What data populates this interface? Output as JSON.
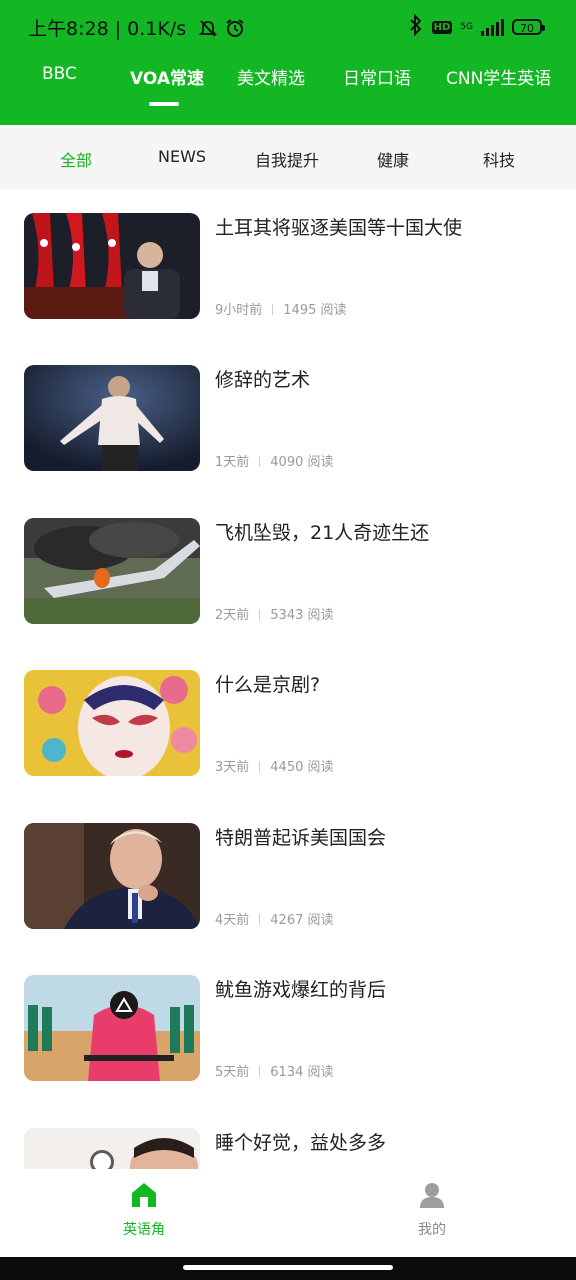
{
  "status": {
    "time": "上午8:28",
    "speed": "0.1K/s",
    "battery": "70",
    "network": "5G"
  },
  "top_tabs": [
    "BBC",
    "VOA常速",
    "美文精选",
    "日常口语",
    "CNN学生英语"
  ],
  "top_active": "VOA常速",
  "sub_tabs": [
    "全部",
    "NEWS",
    "自我提升",
    "健康",
    "科技"
  ],
  "sub_active": "全部",
  "articles": [
    {
      "title": "土耳其将驱逐美国等十国大使",
      "time": "9小时前",
      "reads": "1495 阅读"
    },
    {
      "title": "修辞的艺术",
      "time": "1天前",
      "reads": "4090 阅读"
    },
    {
      "title": "飞机坠毁，21人奇迹生还",
      "time": "2天前",
      "reads": "5343 阅读"
    },
    {
      "title": "什么是京剧?",
      "time": "3天前",
      "reads": "4450 阅读"
    },
    {
      "title": "特朗普起诉美国国会",
      "time": "4天前",
      "reads": "4267 阅读"
    },
    {
      "title": "鱿鱼游戏爆红的背后",
      "time": "5天前",
      "reads": "6134 阅读"
    },
    {
      "title": "睡个好觉，益处多多",
      "time": "",
      "reads": ""
    }
  ],
  "bottom_nav": {
    "english_corner": "英语角",
    "mine": "我的"
  },
  "colors": {
    "accent": "#13b723",
    "text": "#222222",
    "meta": "#9a9a9a"
  }
}
